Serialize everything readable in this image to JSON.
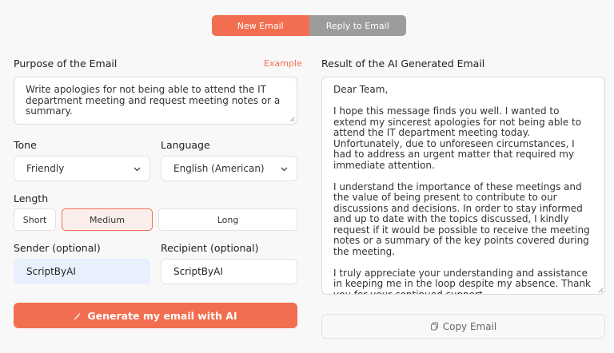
{
  "tabs": {
    "new_email": "New Email",
    "reply_to_email": "Reply to Email"
  },
  "purpose": {
    "label": "Purpose of the Email",
    "example_link": "Example",
    "value": "Write apologies for not being able to attend the IT department meeting and request meeting notes or a summary."
  },
  "tone": {
    "label": "Tone",
    "value": "Friendly"
  },
  "language": {
    "label": "Language",
    "value": "English (American)"
  },
  "length": {
    "label": "Length",
    "options": [
      "Short",
      "Medium",
      "Long"
    ],
    "selected": "Medium"
  },
  "sender": {
    "label": "Sender (optional)",
    "value": "ScriptByAI"
  },
  "recipient": {
    "label": "Recipient (optional)",
    "value": "ScriptByAI"
  },
  "generate_button": "Generate my email with AI",
  "result": {
    "label": "Result of the AI Generated Email",
    "text": "Dear Team,\n\nI hope this message finds you well. I wanted to extend my sincerest apologies for not being able to attend the IT department meeting today. Unfortunately, due to unforeseen circumstances, I had to address an urgent matter that required my immediate attention.\n\nI understand the importance of these meetings and the value of being present to contribute to our discussions and decisions. In order to stay informed and up to date with the topics discussed, I kindly request if it would be possible to receive the meeting notes or a summary of the key points covered during the meeting.\n\nI truly appreciate your understanding and assistance in keeping me in the loop despite my absence. Thank you for your continued support.\n\nWarm regards,"
  },
  "copy_button": "Copy Email",
  "colors": {
    "accent": "#f26e50",
    "inactive_tab": "#9c9c9c",
    "sender_bg": "#e8f0fe"
  }
}
